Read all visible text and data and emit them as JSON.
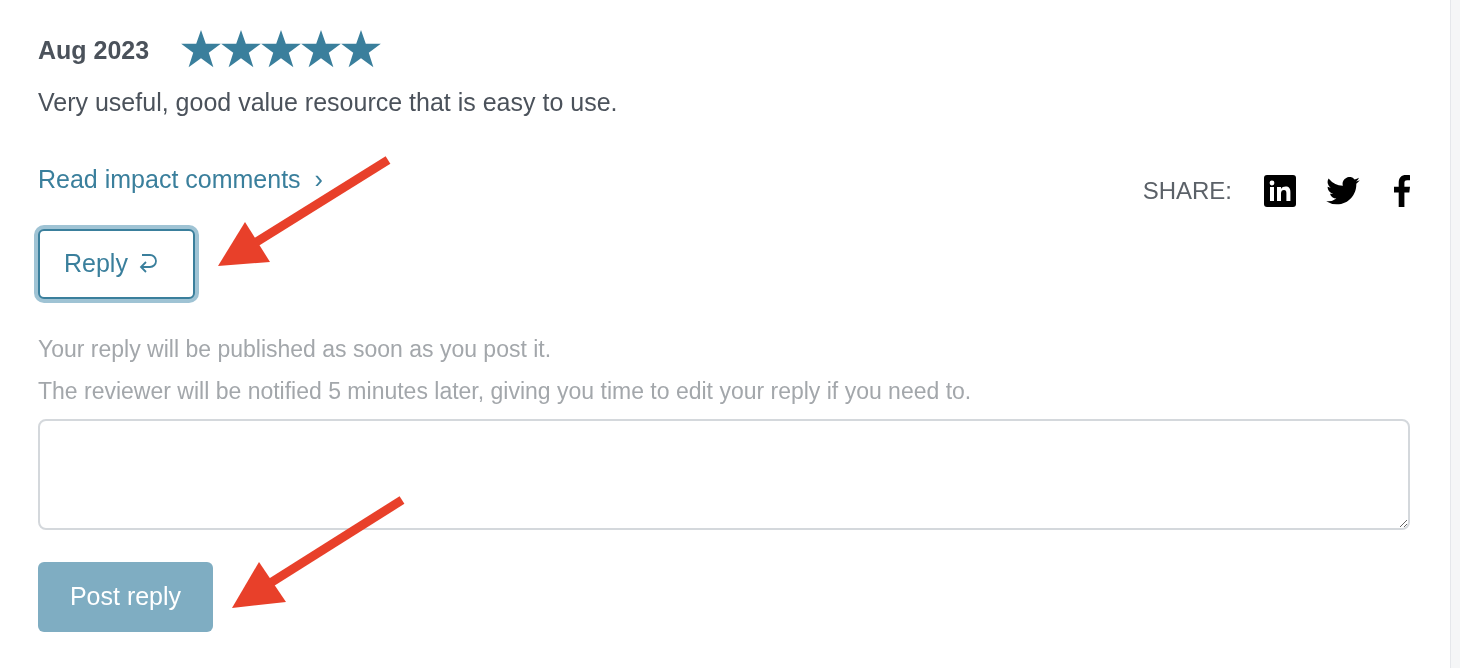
{
  "review": {
    "date": "Aug 2023",
    "stars": 5,
    "text": "Very useful, good value resource that is easy to use."
  },
  "impact_link": {
    "label": "Read impact comments",
    "chevron": "›"
  },
  "share": {
    "label": "SHARE:"
  },
  "reply_button": {
    "label": "Reply"
  },
  "notes": [
    "Your reply will be published as soon as you post it.",
    "The reviewer will be notified 5 minutes later, giving you time to edit your reply if you need to."
  ],
  "post_button": {
    "label": "Post reply",
    "disabled": true
  }
}
